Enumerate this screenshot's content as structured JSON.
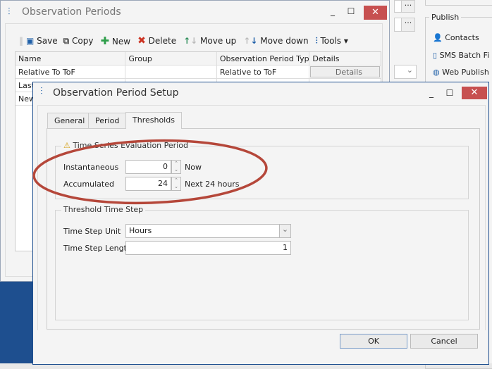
{
  "background": {
    "publish": {
      "label": "Publish",
      "items": [
        {
          "label": "Contacts",
          "icon": "person-icon"
        },
        {
          "label": "SMS Batch Fi",
          "icon": "phone-icon"
        },
        {
          "label": "Web Publish",
          "icon": "globe-icon"
        }
      ]
    },
    "ellipsis": "···"
  },
  "periods_window": {
    "title": "Observation Periods",
    "toolbar": [
      {
        "label": "Save",
        "icon": "save-icon",
        "color": "#1e5fa8"
      },
      {
        "label": "Copy",
        "icon": "copy-icon",
        "color": "#555"
      },
      {
        "label": "New",
        "icon": "plus-icon",
        "color": "#2e9e4a"
      },
      {
        "label": "Delete",
        "icon": "x-icon",
        "color": "#cc3322"
      },
      {
        "label": "Move up",
        "icon": "arrow-up-icon",
        "color": "#2e8e5a"
      },
      {
        "label": "Move down",
        "icon": "arrow-down-icon",
        "color": "#1e5fa8"
      },
      {
        "label": "Tools",
        "icon": "tools-icon",
        "color": "#1e5fa8"
      }
    ],
    "columns": [
      "Name",
      "Group",
      "Observation Period Type",
      "Details"
    ],
    "rows": [
      {
        "name": "Relative To ToF",
        "group": "",
        "type": "Relative to ToF",
        "details": "Details"
      },
      {
        "name": "Last",
        "group": "",
        "type": "",
        "details": ""
      },
      {
        "name": "New",
        "group": "",
        "type": "",
        "details": ""
      }
    ]
  },
  "setup_dialog": {
    "title": "Observation Period Setup",
    "tabs": [
      "General",
      "Period",
      "Thresholds"
    ],
    "active_tab": "Thresholds",
    "evaluation": {
      "label": "Time Series Evaluation Period",
      "instantaneous_label": "Instantaneous",
      "instantaneous_value": "0",
      "instantaneous_desc": "Now",
      "accumulated_label": "Accumulated",
      "accumulated_value": "24",
      "accumulated_desc": "Next 24 hours"
    },
    "time_step": {
      "label": "Threshold Time Step",
      "unit_label": "Time Step Unit",
      "unit_value": "Hours",
      "length_label": "Time Step Length",
      "length_value": "1"
    },
    "ok": "OK",
    "cancel": "Cancel"
  },
  "colors": {
    "accent": "#1e4f8f",
    "close": "#c75050",
    "highlight_ellipse": "#b5473a"
  }
}
